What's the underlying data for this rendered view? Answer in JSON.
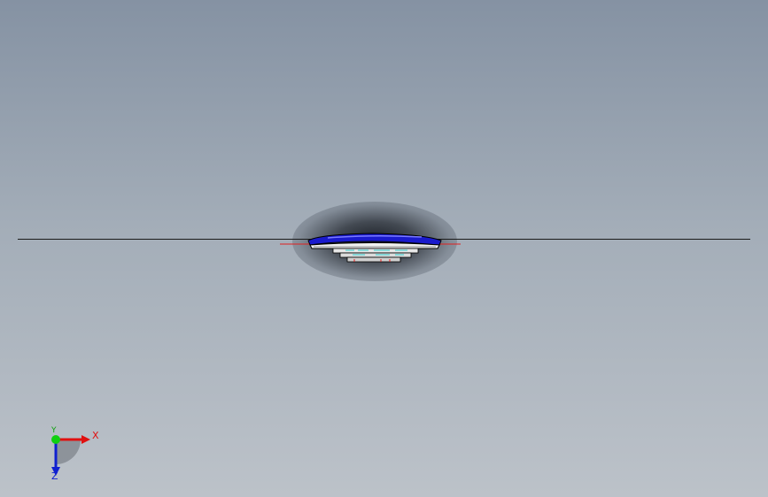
{
  "viewport": {
    "background_top": "#8592a3",
    "background_bottom": "#bcc2c9"
  },
  "model": {
    "hull_color": "#1a1acc",
    "accent_color": "#e02020",
    "detail_color": "#2fd0d0"
  },
  "triad": {
    "x_label": "X",
    "y_label": "Y",
    "z_label": "Z",
    "x_color": "#e01010",
    "y_color": "#10d010",
    "z_color": "#1020d0"
  }
}
